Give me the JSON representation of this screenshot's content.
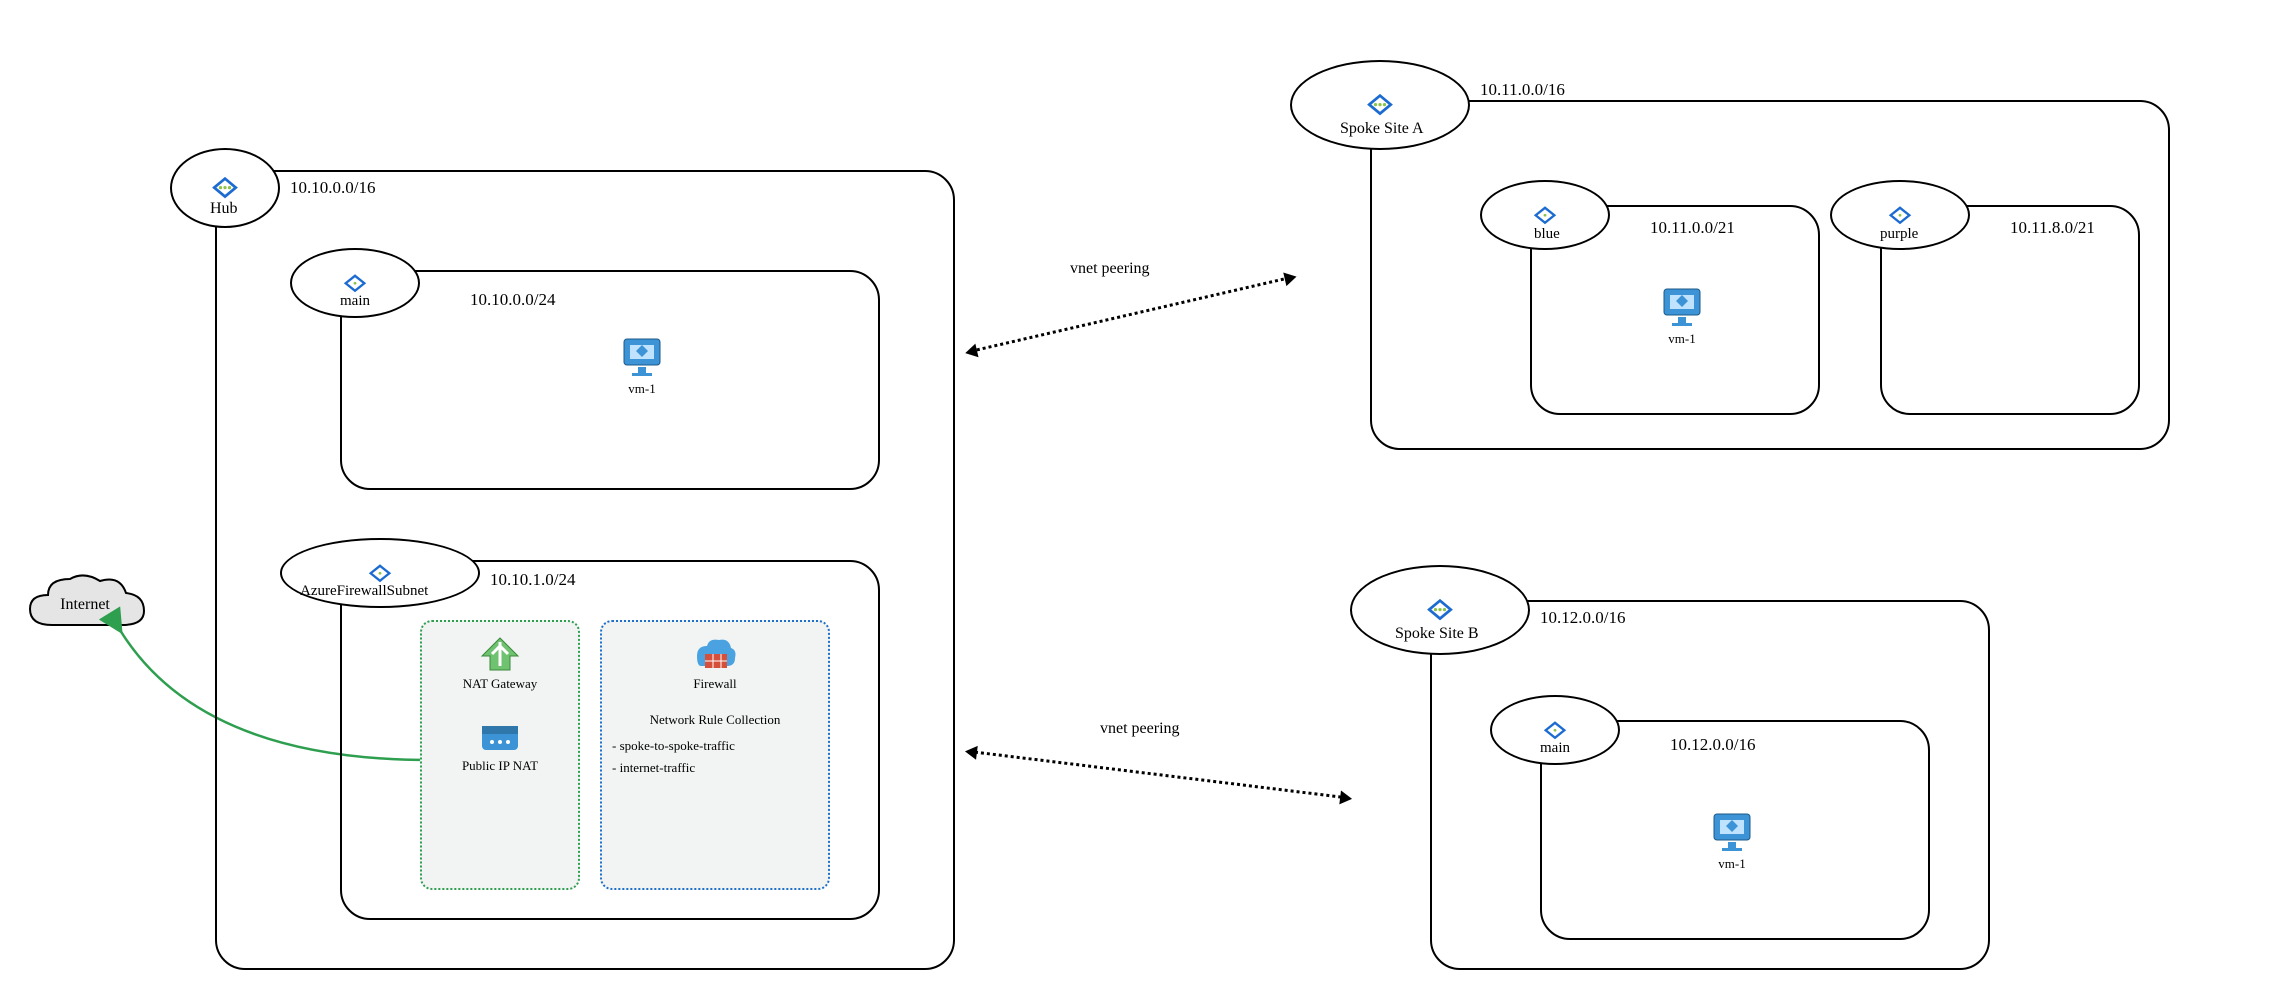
{
  "internet": {
    "label": "Internet"
  },
  "hub": {
    "name": "Hub",
    "cidr": "10.10.0.0/16",
    "subnets": {
      "main": {
        "name": "main",
        "cidr": "10.10.0.0/24",
        "vm": "vm-1"
      },
      "fw": {
        "name": "AzureFirewallSubnet",
        "cidr": "10.10.1.0/24",
        "nat": {
          "gw": "NAT Gateway",
          "pip": "Public IP NAT"
        },
        "firewall": {
          "name": "Firewall",
          "collection_title": "Network Rule Collection",
          "rules": [
            "- spoke-to-spoke-traffic",
            "- internet-traffic"
          ]
        }
      }
    }
  },
  "spokeA": {
    "name": "Spoke Site A",
    "cidr": "10.11.0.0/16",
    "subnets": {
      "blue": {
        "name": "blue",
        "cidr": "10.11.0.0/21",
        "vm": "vm-1"
      },
      "purple": {
        "name": "purple",
        "cidr": "10.11.8.0/21"
      }
    }
  },
  "spokeB": {
    "name": "Spoke Site B",
    "cidr": "10.12.0.0/16",
    "subnets": {
      "main": {
        "name": "main",
        "cidr": "10.12.0.0/16",
        "vm": "vm-1"
      }
    }
  },
  "peering": {
    "labelA": "vnet peering",
    "labelB": "vnet peering"
  }
}
